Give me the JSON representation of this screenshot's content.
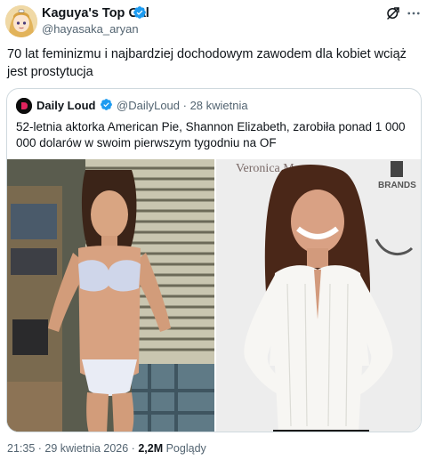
{
  "author": {
    "name": "Kaguya's Top Gal",
    "handle": "@hayasaka_aryan"
  },
  "tweet": {
    "text": "70 lat feminizmu i najbardziej dochodowym zawodem dla kobiet wciąż jest prostytucja"
  },
  "quote": {
    "name": "Daily Loud",
    "handle": "@DailyLoud",
    "date": "· 28 kwietnia",
    "text": "52-letnia aktorka American Pie, Shannon Elizabeth, zarobiła ponad 1 000 000 dolarów w swoim pierwszym tygodniu na OF",
    "images": {
      "right_backdrop_text": "Veronica M",
      "right_backdrop_side": "BRANDS"
    }
  },
  "meta": {
    "time": "21:35 · 29 kwietnia 2026 · ",
    "views": "2,2M",
    "views_label": " Poglądy"
  },
  "colors": {
    "verified": "#1d9bf0",
    "secondary_text": "#536471",
    "border": "#cfd9de"
  },
  "icons": {
    "verified": "verified-badge-icon",
    "grok": "grok-icon",
    "more": "more-icon"
  }
}
